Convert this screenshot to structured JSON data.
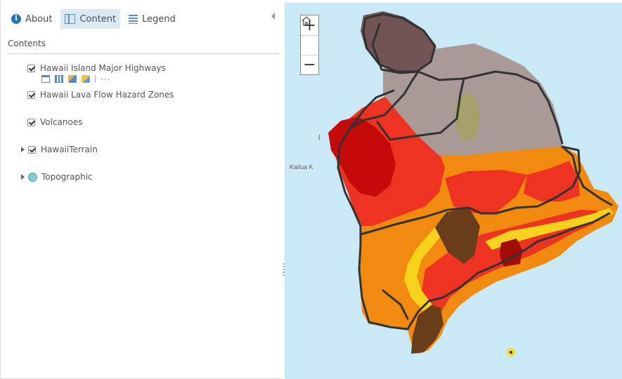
{
  "tabs": [
    {
      "label": "About",
      "icon": "info-icon"
    },
    {
      "label": "Content",
      "icon": "content-icon"
    },
    {
      "label": "Legend",
      "icon": "legend-icon"
    }
  ],
  "contents_title": "Contents",
  "layers": [
    {
      "label": "Hawaii Island Major Highways",
      "checked": true
    },
    {
      "label": "Hawaii Lava Flow Hazard Zones",
      "checked": true
    },
    {
      "label": "Volcanoes",
      "checked": true
    },
    {
      "label": "HawaiiTerrain",
      "checked": true,
      "expandable": true
    },
    {
      "label": "Topographic",
      "basemap": true,
      "expandable": true
    }
  ],
  "layer_tools": [
    "table-icon",
    "attribute-table-icon",
    "change-symbol-icon",
    "analysis-icon",
    "more-options-icon"
  ],
  "more_label": "···",
  "map": {
    "zoom_in_label": "+",
    "home_icon": "home-icon",
    "zoom_out_label": "−",
    "place_label": "Kailua K",
    "place_label_2": "("
  },
  "colors": {
    "ocean": "#c9e9f6",
    "zone_dark_red": "#c40a0a",
    "zone_red": "#ee3322",
    "zone_orange": "#f28a10",
    "zone_yellow": "#f7d21c",
    "zone_brown": "#6a3d1a",
    "zone_mauve": "#a99a98",
    "zone_dark_mauve": "#725455",
    "zone_olive": "#a5a06a",
    "highway": "#333333",
    "accent": "#2b73b6"
  }
}
